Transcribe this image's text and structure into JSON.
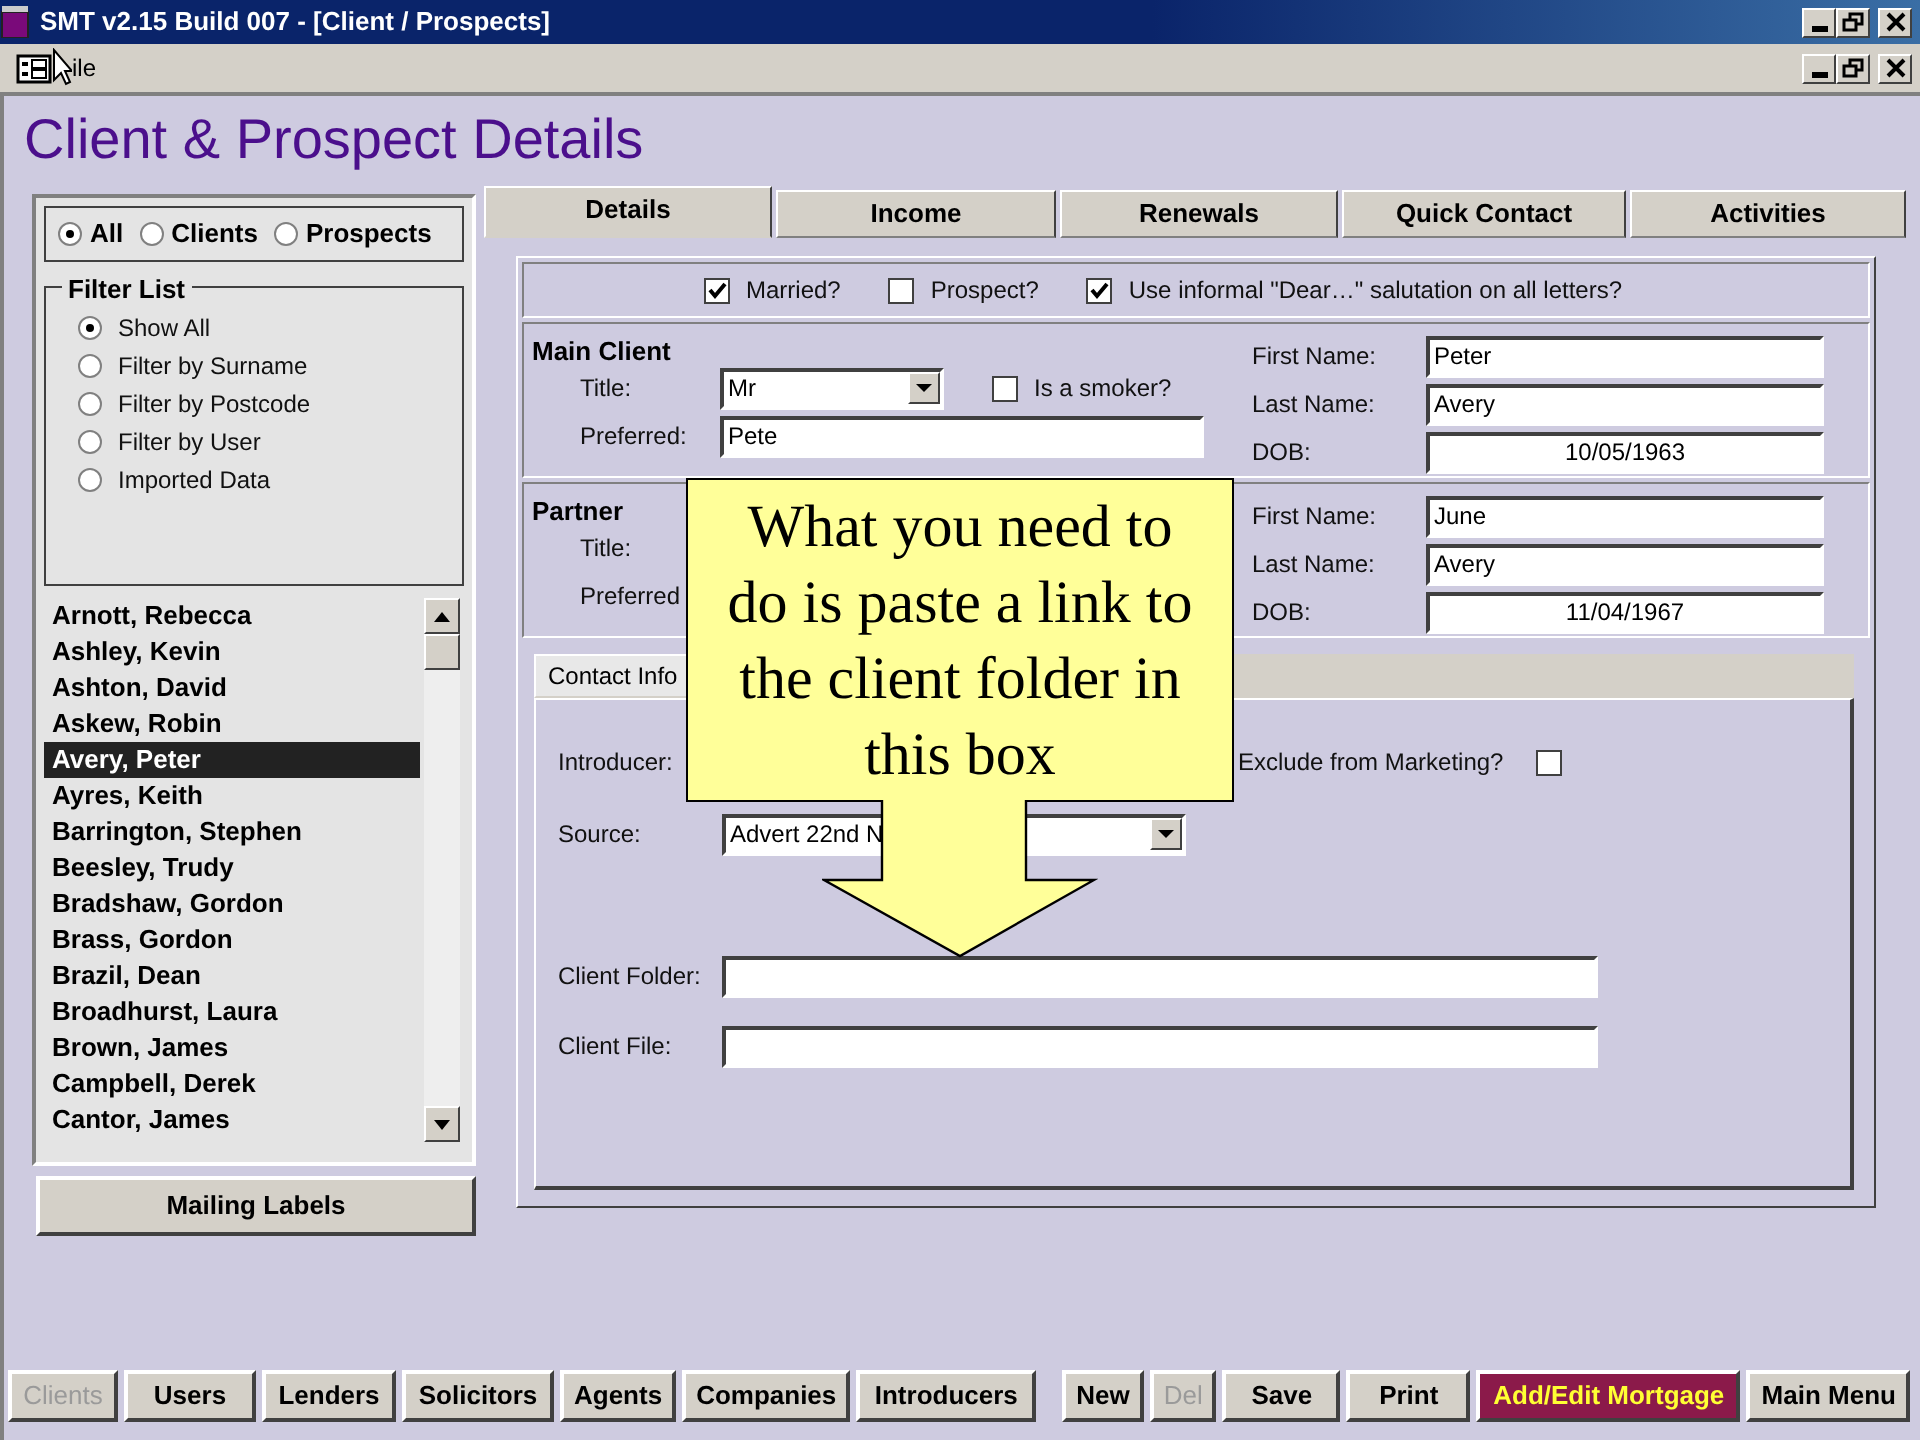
{
  "window": {
    "title": "SMT v2.15 Build 007 - [Client / Prospects]"
  },
  "menu": {
    "items": [
      "ile"
    ]
  },
  "heading": "Client & Prospect Details",
  "client_type": [
    {
      "label": "All",
      "selected": true
    },
    {
      "label": "Clients",
      "selected": false
    },
    {
      "label": "Prospects",
      "selected": false
    }
  ],
  "filter_list": {
    "title": "Filter List",
    "options": [
      {
        "label": "Show All",
        "selected": true
      },
      {
        "label": "Filter by Surname",
        "selected": false
      },
      {
        "label": "Filter by Postcode",
        "selected": false
      },
      {
        "label": "Filter by User",
        "selected": false
      },
      {
        "label": "Imported Data",
        "selected": false
      }
    ]
  },
  "client_list": [
    {
      "name": "Arnott, Rebecca",
      "selected": false
    },
    {
      "name": "Ashley, Kevin",
      "selected": false
    },
    {
      "name": "Ashton, David",
      "selected": false
    },
    {
      "name": "Askew, Robin",
      "selected": false
    },
    {
      "name": "Avery, Peter",
      "selected": true
    },
    {
      "name": "Ayres, Keith",
      "selected": false
    },
    {
      "name": "Barrington, Stephen",
      "selected": false
    },
    {
      "name": "Beesley, Trudy",
      "selected": false
    },
    {
      "name": "Bradshaw, Gordon",
      "selected": false
    },
    {
      "name": "Brass, Gordon",
      "selected": false
    },
    {
      "name": "Brazil, Dean",
      "selected": false
    },
    {
      "name": "Broadhurst, Laura",
      "selected": false
    },
    {
      "name": "Brown, James",
      "selected": false
    },
    {
      "name": "Campbell, Derek",
      "selected": false
    },
    {
      "name": "Cantor, James",
      "selected": false
    }
  ],
  "mailing_labels_button": "Mailing Labels",
  "tabs": [
    {
      "label": "Details",
      "selected": true
    },
    {
      "label": "Income",
      "selected": false
    },
    {
      "label": "Renewals",
      "selected": false
    },
    {
      "label": "Quick Contact",
      "selected": false
    },
    {
      "label": "Activities",
      "selected": false
    }
  ],
  "flags": [
    {
      "label": "Married?",
      "checked": true
    },
    {
      "label": "Prospect?",
      "checked": false
    },
    {
      "label": "Use informal \"Dear…\" salutation on all letters?",
      "checked": true
    }
  ],
  "main_client": {
    "heading": "Main Client",
    "title_label": "Title:",
    "title_value": "Mr",
    "smoker": {
      "label": "Is a smoker?",
      "checked": false
    },
    "preferred_label": "Preferred:",
    "preferred_value": "Pete",
    "fields": [
      {
        "label": "First Name:",
        "value": "Peter"
      },
      {
        "label": "Last Name:",
        "value": "Avery"
      },
      {
        "label": "DOB:",
        "value": "10/05/1963"
      }
    ]
  },
  "partner": {
    "heading": "Partner",
    "title_label": "Title:",
    "preferred_label": "Preferred",
    "fields": [
      {
        "label": "First Name:",
        "value": "June"
      },
      {
        "label": "Last Name:",
        "value": "Avery"
      },
      {
        "label": "DOB:",
        "value": "11/04/1967"
      }
    ]
  },
  "contact_tabs": [
    {
      "label": "Contact Info",
      "selected": true
    }
  ],
  "contact": {
    "introducer_label": "Introducer:",
    "exclude": {
      "label": "Exclude from Marketing?",
      "checked": false
    },
    "source_label": "Source:",
    "source_value": "Advert 22nd N",
    "client_folder_label": "Client Folder:",
    "client_file_label": "Client File:"
  },
  "callout": {
    "text": "What you need to do is paste a link to the client folder in this box"
  },
  "buttons": [
    {
      "label": "Clients",
      "kind": "normal",
      "disabled": true
    },
    {
      "label": "Users",
      "kind": "normal",
      "disabled": false
    },
    {
      "label": "Lenders",
      "kind": "normal",
      "disabled": false
    },
    {
      "label": "Solicitors",
      "kind": "normal",
      "disabled": false
    },
    {
      "label": "Agents",
      "kind": "normal",
      "disabled": false
    },
    {
      "label": "Companies",
      "kind": "normal",
      "disabled": false
    },
    {
      "label": "Introducers",
      "kind": "normal",
      "disabled": false
    },
    {
      "label": "New",
      "kind": "gap",
      "disabled": false
    },
    {
      "label": "Del",
      "kind": "normal",
      "disabled": true
    },
    {
      "label": "Save",
      "kind": "normal",
      "disabled": false
    },
    {
      "label": "Print",
      "kind": "normal",
      "disabled": false
    },
    {
      "label": "Add/Edit Mortgage",
      "kind": "highlight",
      "disabled": false
    },
    {
      "label": "Main Menu",
      "kind": "normal",
      "disabled": false
    }
  ]
}
